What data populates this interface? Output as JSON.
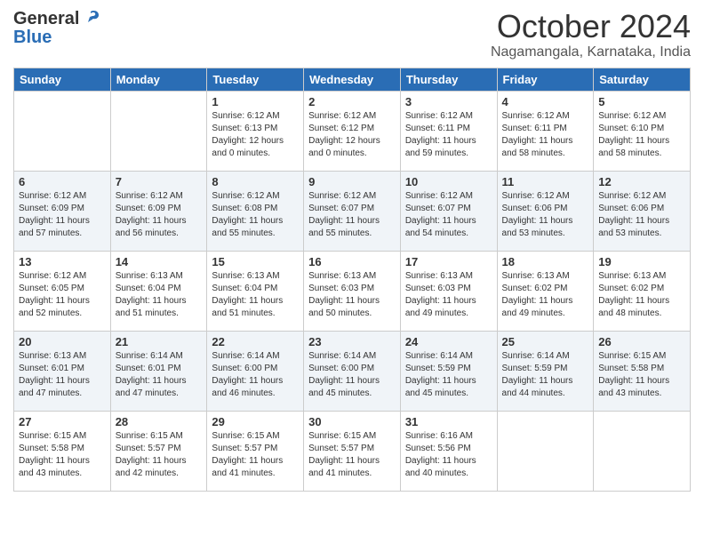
{
  "header": {
    "logo": {
      "line1": "General",
      "line2": "Blue"
    },
    "title": "October 2024",
    "location": "Nagamangala, Karnataka, India"
  },
  "weekdays": [
    "Sunday",
    "Monday",
    "Tuesday",
    "Wednesday",
    "Thursday",
    "Friday",
    "Saturday"
  ],
  "weeks": [
    [
      {
        "day": "",
        "info": ""
      },
      {
        "day": "",
        "info": ""
      },
      {
        "day": "1",
        "info": "Sunrise: 6:12 AM\nSunset: 6:13 PM\nDaylight: 12 hours\nand 0 minutes."
      },
      {
        "day": "2",
        "info": "Sunrise: 6:12 AM\nSunset: 6:12 PM\nDaylight: 12 hours\nand 0 minutes."
      },
      {
        "day": "3",
        "info": "Sunrise: 6:12 AM\nSunset: 6:11 PM\nDaylight: 11 hours\nand 59 minutes."
      },
      {
        "day": "4",
        "info": "Sunrise: 6:12 AM\nSunset: 6:11 PM\nDaylight: 11 hours\nand 58 minutes."
      },
      {
        "day": "5",
        "info": "Sunrise: 6:12 AM\nSunset: 6:10 PM\nDaylight: 11 hours\nand 58 minutes."
      }
    ],
    [
      {
        "day": "6",
        "info": "Sunrise: 6:12 AM\nSunset: 6:09 PM\nDaylight: 11 hours\nand 57 minutes."
      },
      {
        "day": "7",
        "info": "Sunrise: 6:12 AM\nSunset: 6:09 PM\nDaylight: 11 hours\nand 56 minutes."
      },
      {
        "day": "8",
        "info": "Sunrise: 6:12 AM\nSunset: 6:08 PM\nDaylight: 11 hours\nand 55 minutes."
      },
      {
        "day": "9",
        "info": "Sunrise: 6:12 AM\nSunset: 6:07 PM\nDaylight: 11 hours\nand 55 minutes."
      },
      {
        "day": "10",
        "info": "Sunrise: 6:12 AM\nSunset: 6:07 PM\nDaylight: 11 hours\nand 54 minutes."
      },
      {
        "day": "11",
        "info": "Sunrise: 6:12 AM\nSunset: 6:06 PM\nDaylight: 11 hours\nand 53 minutes."
      },
      {
        "day": "12",
        "info": "Sunrise: 6:12 AM\nSunset: 6:06 PM\nDaylight: 11 hours\nand 53 minutes."
      }
    ],
    [
      {
        "day": "13",
        "info": "Sunrise: 6:12 AM\nSunset: 6:05 PM\nDaylight: 11 hours\nand 52 minutes."
      },
      {
        "day": "14",
        "info": "Sunrise: 6:13 AM\nSunset: 6:04 PM\nDaylight: 11 hours\nand 51 minutes."
      },
      {
        "day": "15",
        "info": "Sunrise: 6:13 AM\nSunset: 6:04 PM\nDaylight: 11 hours\nand 51 minutes."
      },
      {
        "day": "16",
        "info": "Sunrise: 6:13 AM\nSunset: 6:03 PM\nDaylight: 11 hours\nand 50 minutes."
      },
      {
        "day": "17",
        "info": "Sunrise: 6:13 AM\nSunset: 6:03 PM\nDaylight: 11 hours\nand 49 minutes."
      },
      {
        "day": "18",
        "info": "Sunrise: 6:13 AM\nSunset: 6:02 PM\nDaylight: 11 hours\nand 49 minutes."
      },
      {
        "day": "19",
        "info": "Sunrise: 6:13 AM\nSunset: 6:02 PM\nDaylight: 11 hours\nand 48 minutes."
      }
    ],
    [
      {
        "day": "20",
        "info": "Sunrise: 6:13 AM\nSunset: 6:01 PM\nDaylight: 11 hours\nand 47 minutes."
      },
      {
        "day": "21",
        "info": "Sunrise: 6:14 AM\nSunset: 6:01 PM\nDaylight: 11 hours\nand 47 minutes."
      },
      {
        "day": "22",
        "info": "Sunrise: 6:14 AM\nSunset: 6:00 PM\nDaylight: 11 hours\nand 46 minutes."
      },
      {
        "day": "23",
        "info": "Sunrise: 6:14 AM\nSunset: 6:00 PM\nDaylight: 11 hours\nand 45 minutes."
      },
      {
        "day": "24",
        "info": "Sunrise: 6:14 AM\nSunset: 5:59 PM\nDaylight: 11 hours\nand 45 minutes."
      },
      {
        "day": "25",
        "info": "Sunrise: 6:14 AM\nSunset: 5:59 PM\nDaylight: 11 hours\nand 44 minutes."
      },
      {
        "day": "26",
        "info": "Sunrise: 6:15 AM\nSunset: 5:58 PM\nDaylight: 11 hours\nand 43 minutes."
      }
    ],
    [
      {
        "day": "27",
        "info": "Sunrise: 6:15 AM\nSunset: 5:58 PM\nDaylight: 11 hours\nand 43 minutes."
      },
      {
        "day": "28",
        "info": "Sunrise: 6:15 AM\nSunset: 5:57 PM\nDaylight: 11 hours\nand 42 minutes."
      },
      {
        "day": "29",
        "info": "Sunrise: 6:15 AM\nSunset: 5:57 PM\nDaylight: 11 hours\nand 41 minutes."
      },
      {
        "day": "30",
        "info": "Sunrise: 6:15 AM\nSunset: 5:57 PM\nDaylight: 11 hours\nand 41 minutes."
      },
      {
        "day": "31",
        "info": "Sunrise: 6:16 AM\nSunset: 5:56 PM\nDaylight: 11 hours\nand 40 minutes."
      },
      {
        "day": "",
        "info": ""
      },
      {
        "day": "",
        "info": ""
      }
    ]
  ]
}
